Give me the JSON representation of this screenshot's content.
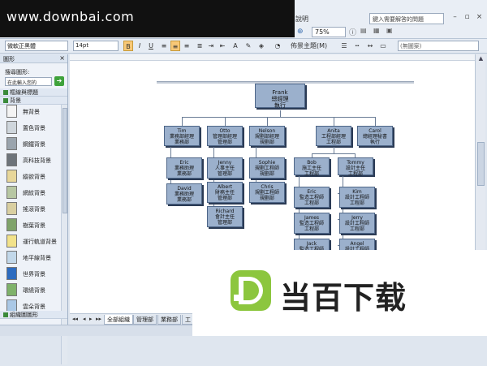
{
  "watermark_top": "www.downbai.com",
  "menu": {
    "help": "說明"
  },
  "help_search_placeholder": "鍵入需要解答的問題",
  "zoom": "75%",
  "format": {
    "font": "微軟正黑體",
    "size": "14pt",
    "theme_label": "佈景主題(M)",
    "line_pattern": "(無圖案)"
  },
  "sidebar": {
    "title": "圖形",
    "search_label": "搜尋圖形:",
    "search_placeholder": "在此輸入您的",
    "categories": [
      "框線與標題",
      "背景"
    ],
    "items": [
      "無背景",
      "置色背景",
      "鋼鐵背景",
      "高科技背景",
      "縱欲背景",
      "網紋背景",
      "搖滾背景",
      "樹葉背景",
      "運行軌道背景",
      "地平線背景",
      "世界背景",
      "環繞背景",
      "雲朵背景"
    ],
    "bottom_category": "組織圖圖形"
  },
  "tabs": [
    "全部組織",
    "管理部",
    "業務部",
    "工"
  ],
  "org": {
    "top": {
      "name": "Frank",
      "line1": "總經理",
      "line2": "執行"
    },
    "managers": [
      {
        "name": "Tim",
        "line1": "業務部經理",
        "line2": "業務部"
      },
      {
        "name": "Otto",
        "line1": "管理部經理",
        "line2": "管理部"
      },
      {
        "name": "Nelson",
        "line1": "規劃部經理",
        "line2": "規劃部"
      },
      {
        "name": "Anita",
        "line1": "工程部經理",
        "line2": "工程部"
      },
      {
        "name": "Carol",
        "line1": "總經理秘書",
        "line2": "執行"
      }
    ],
    "tim_reports": [
      {
        "name": "Eric",
        "line1": "業務助理",
        "line2": "業務部"
      },
      {
        "name": "David",
        "line1": "業務助理",
        "line2": "業務部"
      }
    ],
    "otto_reports": [
      {
        "name": "Jenny",
        "line1": "人事主任",
        "line2": "管理部"
      },
      {
        "name": "Albert",
        "line1": "財務主任",
        "line2": "管理部"
      },
      {
        "name": "Richard",
        "line1": "會計主任",
        "line2": "管理部"
      }
    ],
    "nelson_reports": [
      {
        "name": "Sophie",
        "line1": "規劃工程師",
        "line2": "規劃部"
      },
      {
        "name": "Chris",
        "line1": "規劃工程師",
        "line2": "規劃部"
      }
    ],
    "anita_leads": [
      {
        "name": "Bob",
        "line1": "施工主任",
        "line2": "工程部"
      },
      {
        "name": "Tommy",
        "line1": "設計主任",
        "line2": "工程部"
      }
    ],
    "bob_reports": [
      {
        "name": "Eric",
        "line1": "監造工程師",
        "line2": "工程部"
      },
      {
        "name": "James",
        "line1": "監造工程師",
        "line2": "工程部"
      },
      {
        "name": "Jack",
        "line1": "監造工程師",
        "line2": ""
      }
    ],
    "tommy_reports": [
      {
        "name": "Kim",
        "line1": "設計工程師",
        "line2": "工程部"
      },
      {
        "name": "Jerry",
        "line1": "設計工程師",
        "line2": "工程部"
      },
      {
        "name": "Angel",
        "line1": "設計工程師",
        "line2": ""
      }
    ]
  },
  "watermark_bottom": "当百下载"
}
